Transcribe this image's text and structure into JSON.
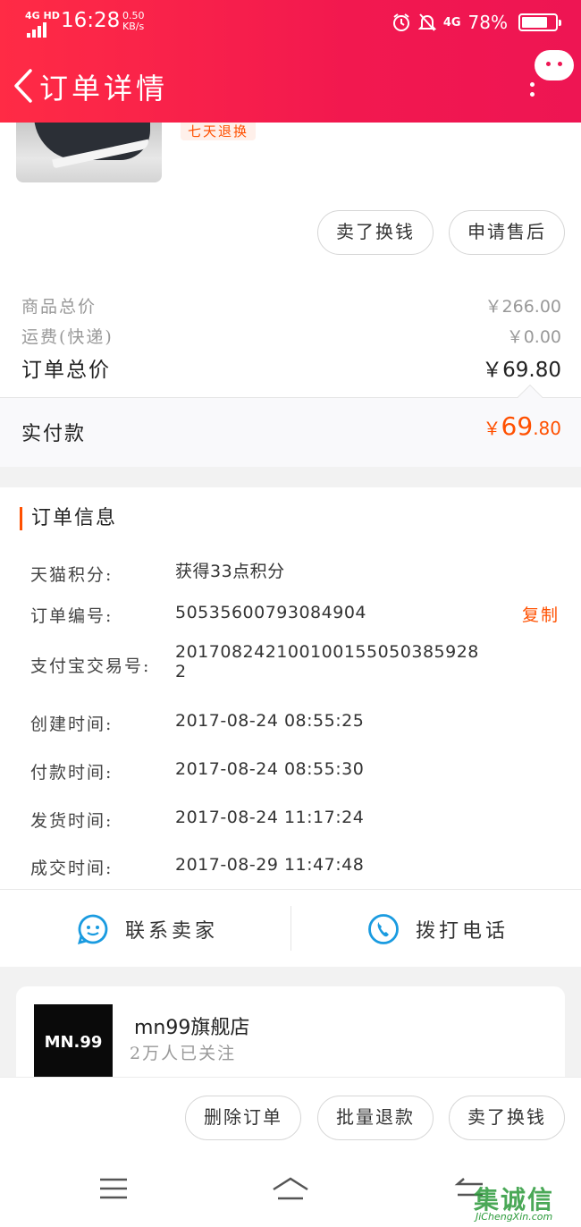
{
  "status_bar": {
    "network": "4G HD",
    "time": "16:28",
    "speed_value": "0.50",
    "speed_unit": "KB/s",
    "signal_label": "4G",
    "battery": "78%",
    "battery_level": 0.78
  },
  "header": {
    "title": "订单详情"
  },
  "product": {
    "service_badge": "七天退换"
  },
  "product_actions": {
    "sell": "卖了换钱",
    "after_sale": "申请售后"
  },
  "price_summary": {
    "goods_total_label": "商品总价",
    "goods_total_value": "￥266.00",
    "shipping_label": "运费(快递)",
    "shipping_value": "￥0.00",
    "order_total_label": "订单总价",
    "order_total_value": "￥69.80",
    "paid_label": "实付款",
    "paid_currency": "￥",
    "paid_int": "69",
    "paid_dec": ".80"
  },
  "order_info": {
    "title": "订单信息",
    "copy_label": "复制",
    "rows": [
      {
        "label": "天猫积分:",
        "value": "获得33点积分"
      },
      {
        "label": "订单编号:",
        "value": "50535600793084904"
      },
      {
        "label": "支付宝交易号:",
        "value": "2017082421001001550503859282"
      },
      {
        "label": "创建时间:",
        "value": "2017-08-24 08:55:25"
      },
      {
        "label": "付款时间:",
        "value": "2017-08-24 08:55:30"
      },
      {
        "label": "发货时间:",
        "value": "2017-08-24 11:17:24"
      },
      {
        "label": "成交时间:",
        "value": "2017-08-29 11:47:48"
      }
    ],
    "contact_seller": "联系卖家",
    "call_phone": "拨打电话"
  },
  "store": {
    "logo_text": "MN.99",
    "name": "mn99旗舰店",
    "followers": "2万人已关注"
  },
  "bottom_actions": {
    "delete": "删除订单",
    "batch_refund": "批量退款",
    "sell": "卖了换钱"
  },
  "watermark": {
    "chars": "集诚信",
    "url": "JiChengXin.com"
  },
  "colors": {
    "brand_red": "#ee1553",
    "accent_orange": "#ff5000",
    "icon_blue": "#1a9be0"
  }
}
